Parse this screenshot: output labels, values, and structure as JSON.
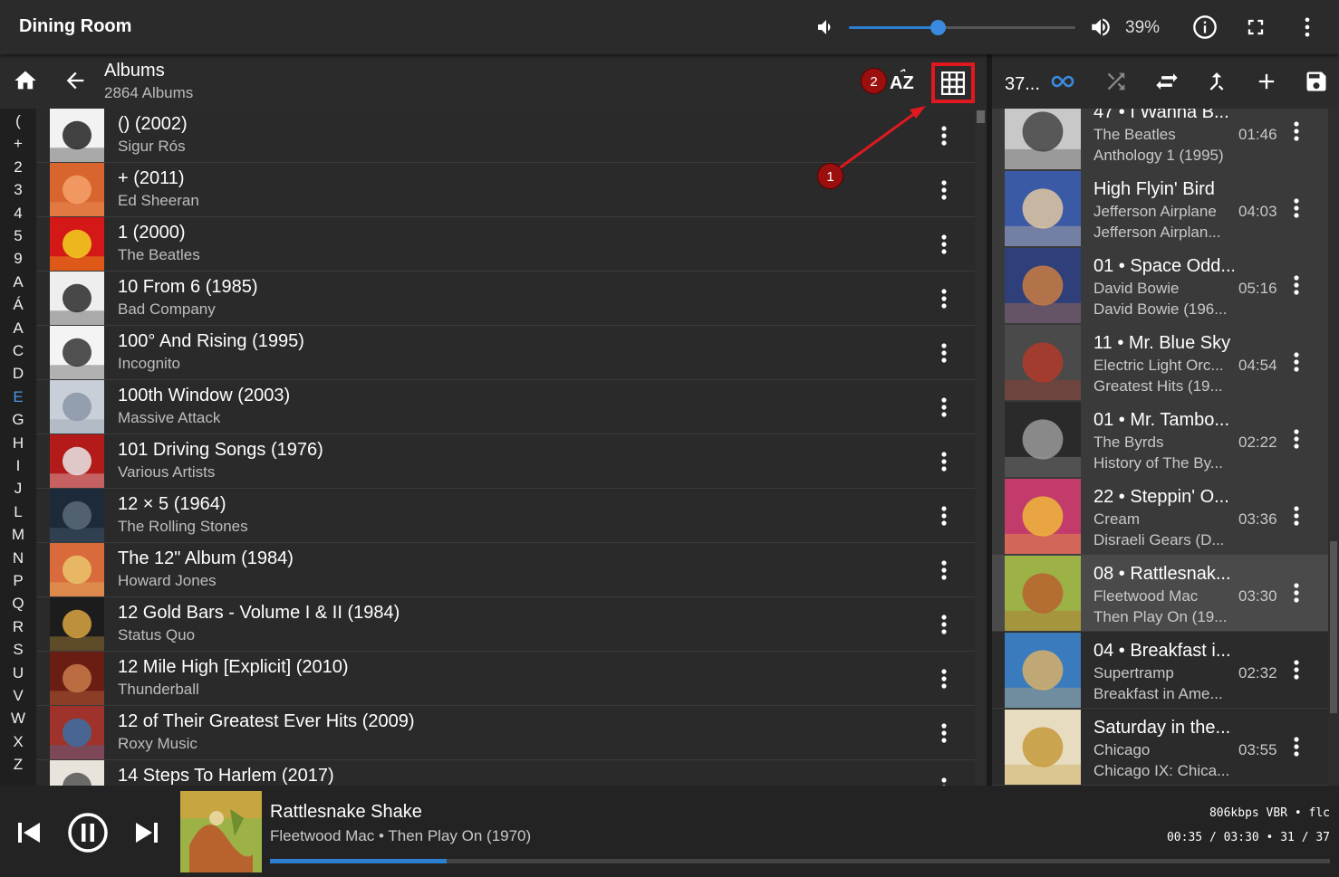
{
  "topbar": {
    "title": "Dining Room",
    "volume_text": "39%",
    "volume_level": 0.39,
    "icons": [
      "volume-down-icon",
      "volume-up-icon",
      "info-icon",
      "fullscreen-icon",
      "more-vert-icon"
    ]
  },
  "browse": {
    "title": "Albums",
    "subtitle": "2864 Albums",
    "sort_label": "AZ"
  },
  "alphabet": [
    "(",
    "+",
    "2",
    "3",
    "4",
    "5",
    "9",
    "A",
    "Á",
    "A",
    "C",
    "D",
    "E",
    "G",
    "H",
    "I",
    "J",
    "L",
    "M",
    "N",
    "P",
    "Q",
    "R",
    "S",
    "U",
    "V",
    "W",
    "X",
    "Z"
  ],
  "alphabet_active": "E",
  "albums": [
    {
      "title": "() (2002)",
      "artist": "Sigur Rós"
    },
    {
      "title": "+ (2011)",
      "artist": "Ed Sheeran"
    },
    {
      "title": "1 (2000)",
      "artist": "The Beatles"
    },
    {
      "title": "10 From 6 (1985)",
      "artist": "Bad Company"
    },
    {
      "title": "100° And Rising (1995)",
      "artist": "Incognito"
    },
    {
      "title": "100th Window (2003)",
      "artist": "Massive Attack"
    },
    {
      "title": "101 Driving Songs (1976)",
      "artist": "Various Artists"
    },
    {
      "title": "12 × 5 (1964)",
      "artist": "The Rolling Stones"
    },
    {
      "title": "The 12\" Album (1984)",
      "artist": "Howard Jones"
    },
    {
      "title": "12 Gold Bars - Volume I & II (1984)",
      "artist": "Status Quo"
    },
    {
      "title": "12 Mile High [Explicit] (2010)",
      "artist": "Thunderball"
    },
    {
      "title": "12 of Their Greatest Ever Hits (2009)",
      "artist": "Roxy Music"
    },
    {
      "title": "14 Steps To Harlem (2017)",
      "artist": ""
    }
  ],
  "queue": {
    "count": "37...",
    "tracks": [
      {
        "title": "47 • I Wanna B...",
        "artist": "The Beatles",
        "album": "Anthology 1 (1995)",
        "duration": "01:46",
        "state": "played"
      },
      {
        "title": "High Flyin' Bird",
        "artist": "Jefferson Airplane",
        "album": "Jefferson Airplan...",
        "duration": "04:03",
        "state": "played"
      },
      {
        "title": "01 • Space Odd...",
        "artist": "David Bowie",
        "album": "David Bowie (196...",
        "duration": "05:16",
        "state": "played"
      },
      {
        "title": "11 • Mr. Blue Sky",
        "artist": "Electric Light Orc...",
        "album": "Greatest Hits (19...",
        "duration": "04:54",
        "state": "played"
      },
      {
        "title": "01 • Mr. Tambo...",
        "artist": "The Byrds",
        "album": "History of The By...",
        "duration": "02:22",
        "state": "played"
      },
      {
        "title": "22 • Steppin' O...",
        "artist": "Cream",
        "album": "Disraeli Gears (D...",
        "duration": "03:36",
        "state": "played"
      },
      {
        "title": "08 • Rattlesnak...",
        "artist": "Fleetwood Mac",
        "album": "Then Play On (19...",
        "duration": "03:30",
        "state": "current"
      },
      {
        "title": "04 • Breakfast i...",
        "artist": "Supertramp",
        "album": "Breakfast in Ame...",
        "duration": "02:32",
        "state": "next"
      },
      {
        "title": "Saturday in the...",
        "artist": "Chicago",
        "album": "Chicago IX: Chica...",
        "duration": "03:55",
        "state": "next"
      }
    ]
  },
  "now_playing": {
    "title": "Rattlesnake Shake",
    "subtitle": "Fleetwood Mac • Then Play On (1970)",
    "tech": "806kbps VBR • flc",
    "time": "00:35 / 03:30 • 31 / 37",
    "progress": 0.167
  },
  "annotations": {
    "badge_1": "1",
    "badge_2": "2",
    "color": "#e0181f"
  }
}
